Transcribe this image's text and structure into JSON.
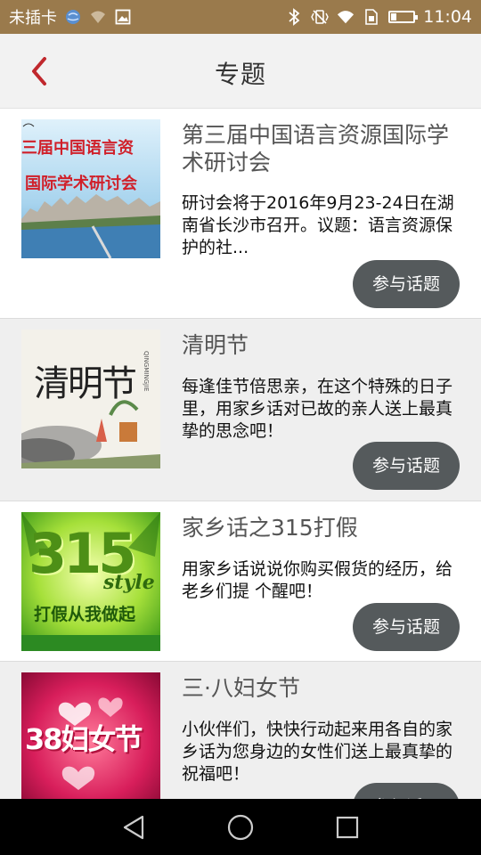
{
  "status_bar": {
    "carrier": "未插卡",
    "time": "11:04",
    "icons": [
      "globe-icon",
      "wifi-off-icon",
      "image-icon",
      "bluetooth-icon",
      "vibrate-icon",
      "wifi-icon",
      "sim-icon",
      "battery-icon"
    ]
  },
  "header": {
    "title": "专题",
    "back_icon": "chevron-left-icon",
    "accent_color": "#c0282d"
  },
  "topics": [
    {
      "title": "第三届中国语言资源国际学术研讨会",
      "thumb_line1": "三届中国语言资",
      "thumb_line2": "国际学术研讨会",
      "description": "研讨会将于2016年9月23-24日在湖南省长沙市召开。议题：语言资源保护的社...",
      "button": "参与话题"
    },
    {
      "title": "清明节",
      "thumb_big": "清明节",
      "thumb_small": "QINGMINGJIE",
      "description": "每逢佳节倍思亲，在这个特殊的日子里，用家乡话对已故的亲人送上最真挚的思念吧！",
      "button": "参与话题"
    },
    {
      "title": "家乡话之315打假",
      "thumb_big": "315",
      "thumb_style": "style",
      "thumb_line": "打假从我做起",
      "description": "用家乡话说说你购买假货的经历，给老乡们提 个醒吧！",
      "button": "参与话题"
    },
    {
      "title": "三·八妇女节",
      "thumb_big": "38妇女节",
      "description": "小伙伴们，快快行动起来用各自的家乡话为您身边的女性们送上最真挚的祝福吧！",
      "button": "参与话题"
    }
  ],
  "nav_bar": {
    "icons": [
      "back-triangle-icon",
      "home-circle-icon",
      "recents-square-icon"
    ]
  }
}
